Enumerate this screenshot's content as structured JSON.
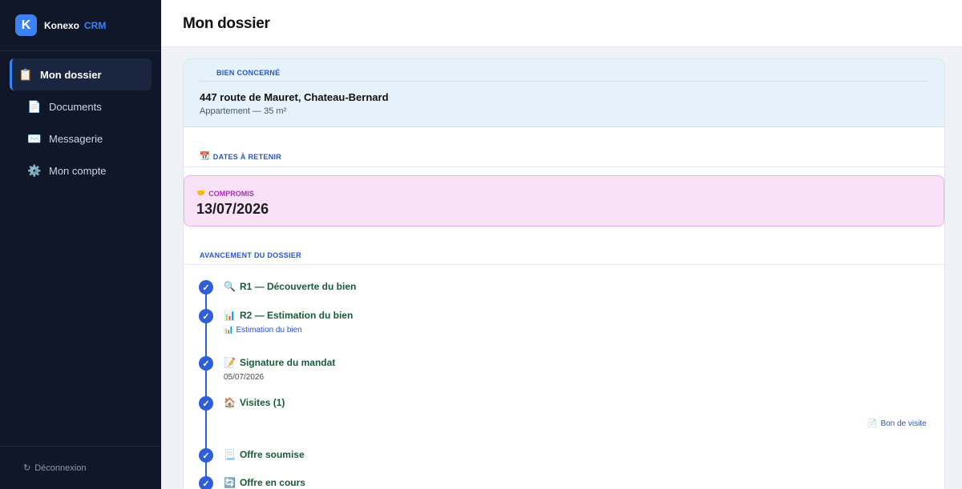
{
  "brand": {
    "logo_letter": "K",
    "name": "Konexo",
    "suffix": "CRM"
  },
  "sidebar": {
    "items": [
      {
        "label": "Mon dossier",
        "icon": "clipboard-icon",
        "glyph": "📋",
        "active": true
      },
      {
        "label": "Documents",
        "icon": "document-icon",
        "glyph": "📄",
        "active": false
      },
      {
        "label": "Messagerie",
        "icon": "envelope-icon",
        "glyph": "✉️",
        "active": false
      },
      {
        "label": "Mon compte",
        "icon": "gear-icon",
        "glyph": "⚙️",
        "active": false
      }
    ],
    "logout": {
      "icon_glyph": "↻",
      "label": "Déconnexion"
    }
  },
  "header": {
    "title": "Mon dossier"
  },
  "bien": {
    "section_label": "BIEN CONCERNÉ",
    "address": "447 route de Mauret, Chateau-Bernard",
    "type": "Appartement — 35 m²"
  },
  "dates": {
    "icon_glyph": "📆",
    "section_label": "DATES À RETENIR",
    "compromis": {
      "icon_glyph": "🤝",
      "label": "COMPROMIS",
      "date": "13/07/2026"
    }
  },
  "avancement": {
    "section_label": "AVANCEMENT DU DOSSIER",
    "steps": [
      {
        "icon_glyph": "🔍",
        "title": "R1 — Découverte du bien",
        "check": "✓"
      },
      {
        "icon_glyph": "📊",
        "title": "R2 — Estimation du bien",
        "check": "✓",
        "link_icon": "📊",
        "link": "Estimation du bien"
      },
      {
        "icon_glyph": "📝",
        "title": "Signature du mandat",
        "check": "✓",
        "sub": "05/07/2026"
      },
      {
        "icon_glyph": "🏠",
        "title": "Visites (1)",
        "check": "✓"
      },
      {
        "icon_glyph": "📃",
        "title": "Offre soumise",
        "check": "✓"
      },
      {
        "icon_glyph": "🔄",
        "title": "Offre en cours",
        "check": "✓"
      }
    ],
    "bon_visite": {
      "icon_glyph": "📄",
      "label": "Bon de visite"
    }
  },
  "colors": {
    "sidebar_bg": "#0f1729",
    "accent": "#3b82f6",
    "timeline": "#2f5fd8",
    "compromis_bg": "#f9e1f8",
    "step_title": "#1a5a3a"
  }
}
